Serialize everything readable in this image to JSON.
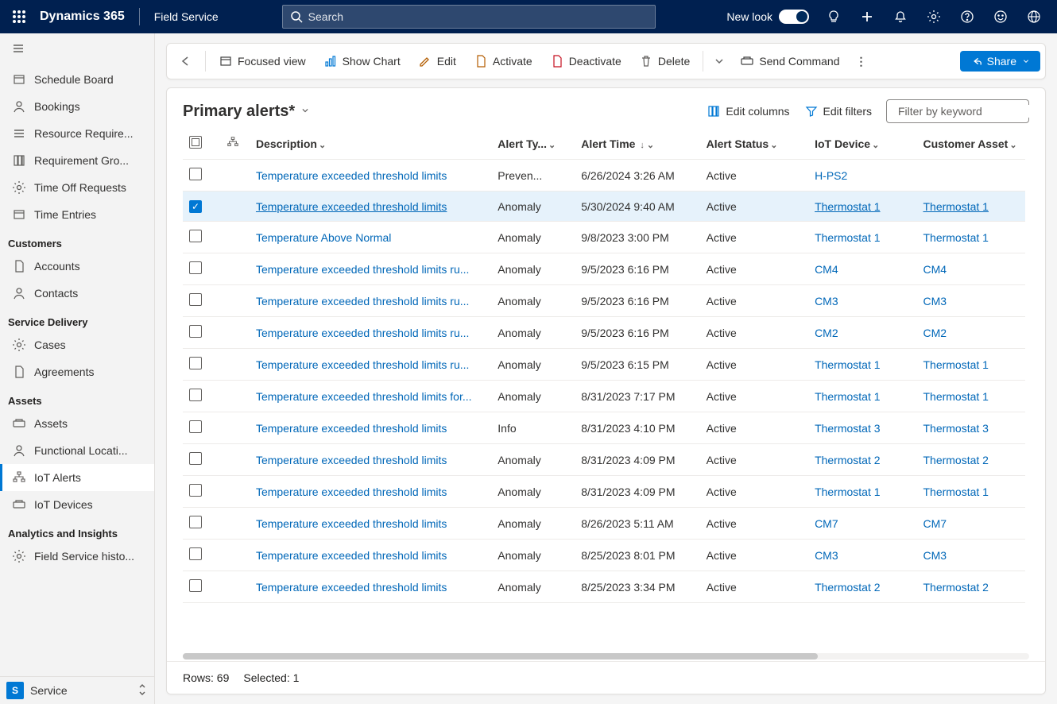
{
  "topbar": {
    "brand": "Dynamics 365",
    "module": "Field Service",
    "search_placeholder": "Search",
    "newlook_label": "New look"
  },
  "sidebar": {
    "groups": [
      {
        "items": [
          {
            "label": "Schedule Board",
            "icon": "calendar"
          },
          {
            "label": "Bookings",
            "icon": "people"
          },
          {
            "label": "Resource Require...",
            "icon": "list"
          },
          {
            "label": "Requirement Gro...",
            "icon": "grid"
          },
          {
            "label": "Time Off Requests",
            "icon": "clock"
          },
          {
            "label": "Time Entries",
            "icon": "calendar"
          }
        ]
      },
      {
        "title": "Customers",
        "items": [
          {
            "label": "Accounts",
            "icon": "building"
          },
          {
            "label": "Contacts",
            "icon": "person"
          }
        ]
      },
      {
        "title": "Service Delivery",
        "items": [
          {
            "label": "Cases",
            "icon": "wrench"
          },
          {
            "label": "Agreements",
            "icon": "doc"
          }
        ]
      },
      {
        "title": "Assets",
        "items": [
          {
            "label": "Assets",
            "icon": "cube"
          },
          {
            "label": "Functional Locati...",
            "icon": "pin"
          },
          {
            "label": "IoT Alerts",
            "icon": "iot",
            "active": true
          },
          {
            "label": "IoT Devices",
            "icon": "device"
          }
        ]
      },
      {
        "title": "Analytics and Insights",
        "items": [
          {
            "label": "Field Service histo...",
            "icon": "gauge"
          }
        ]
      }
    ],
    "bottom_badge": "S",
    "bottom_label": "Service"
  },
  "commands": {
    "focused": "Focused view",
    "show_chart": "Show Chart",
    "edit": "Edit",
    "activate": "Activate",
    "deactivate": "Deactivate",
    "delete": "Delete",
    "send_command": "Send Command",
    "share": "Share"
  },
  "grid": {
    "title": "Primary alerts*",
    "edit_columns": "Edit columns",
    "edit_filters": "Edit filters",
    "filter_placeholder": "Filter by keyword",
    "columns": {
      "description": "Description",
      "alert_type": "Alert Ty...",
      "alert_time": "Alert Time",
      "alert_status": "Alert Status",
      "iot_device": "IoT Device",
      "customer_asset": "Customer Asset"
    },
    "rows": [
      {
        "desc": "Temperature exceeded threshold limits",
        "type": "Preven...",
        "time": "6/26/2024 3:26 AM",
        "status": "Active",
        "device": "H-PS2",
        "asset": ""
      },
      {
        "desc": "Temperature exceeded threshold limits",
        "type": "Anomaly",
        "time": "5/30/2024 9:40 AM",
        "status": "Active",
        "device": "Thermostat 1",
        "asset": "Thermostat 1",
        "selected": true
      },
      {
        "desc": "Temperature Above Normal",
        "type": "Anomaly",
        "time": "9/8/2023 3:00 PM",
        "status": "Active",
        "device": "Thermostat 1",
        "asset": "Thermostat 1"
      },
      {
        "desc": "Temperature exceeded threshold limits ru...",
        "type": "Anomaly",
        "time": "9/5/2023 6:16 PM",
        "status": "Active",
        "device": "CM4",
        "asset": "CM4"
      },
      {
        "desc": "Temperature exceeded threshold limits ru...",
        "type": "Anomaly",
        "time": "9/5/2023 6:16 PM",
        "status": "Active",
        "device": "CM3",
        "asset": "CM3"
      },
      {
        "desc": "Temperature exceeded threshold limits ru...",
        "type": "Anomaly",
        "time": "9/5/2023 6:16 PM",
        "status": "Active",
        "device": "CM2",
        "asset": "CM2"
      },
      {
        "desc": "Temperature exceeded threshold limits ru...",
        "type": "Anomaly",
        "time": "9/5/2023 6:15 PM",
        "status": "Active",
        "device": "Thermostat 1",
        "asset": "Thermostat 1"
      },
      {
        "desc": "Temperature exceeded threshold limits for...",
        "type": "Anomaly",
        "time": "8/31/2023 7:17 PM",
        "status": "Active",
        "device": "Thermostat 1",
        "asset": "Thermostat 1"
      },
      {
        "desc": "Temperature exceeded threshold limits",
        "type": "Info",
        "time": "8/31/2023 4:10 PM",
        "status": "Active",
        "device": "Thermostat 3",
        "asset": "Thermostat 3"
      },
      {
        "desc": "Temperature exceeded threshold limits",
        "type": "Anomaly",
        "time": "8/31/2023 4:09 PM",
        "status": "Active",
        "device": "Thermostat 2",
        "asset": "Thermostat 2"
      },
      {
        "desc": "Temperature exceeded threshold limits",
        "type": "Anomaly",
        "time": "8/31/2023 4:09 PM",
        "status": "Active",
        "device": "Thermostat 1",
        "asset": "Thermostat 1"
      },
      {
        "desc": "Temperature exceeded threshold limits",
        "type": "Anomaly",
        "time": "8/26/2023 5:11 AM",
        "status": "Active",
        "device": "CM7",
        "asset": "CM7"
      },
      {
        "desc": "Temperature exceeded threshold limits",
        "type": "Anomaly",
        "time": "8/25/2023 8:01 PM",
        "status": "Active",
        "device": "CM3",
        "asset": "CM3"
      },
      {
        "desc": "Temperature exceeded threshold limits",
        "type": "Anomaly",
        "time": "8/25/2023 3:34 PM",
        "status": "Active",
        "device": "Thermostat 2",
        "asset": "Thermostat 2"
      }
    ],
    "footer_rows": "Rows: 69",
    "footer_selected": "Selected: 1"
  }
}
